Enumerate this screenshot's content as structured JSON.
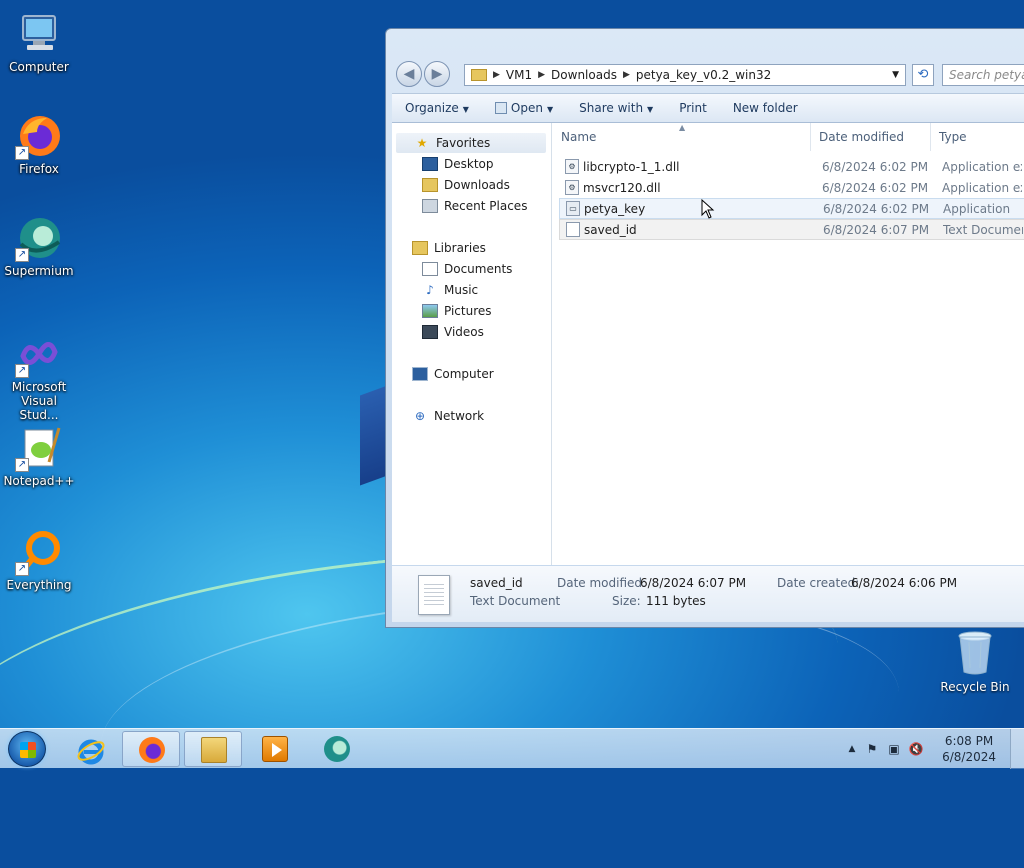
{
  "desktop": {
    "icons": [
      {
        "label": "Computer"
      },
      {
        "label": "Firefox"
      },
      {
        "label": "Supermium"
      },
      {
        "label": "Microsoft Visual Stud..."
      },
      {
        "label": "Notepad++"
      },
      {
        "label": "Everything"
      }
    ],
    "recycle_bin": "Recycle Bin"
  },
  "explorer": {
    "breadcrumb": [
      "VM1",
      "Downloads",
      "petya_key_v0.2_win32"
    ],
    "search_placeholder": "Search petya_k",
    "toolbar": {
      "organize": "Organize",
      "open": "Open",
      "share_with": "Share with",
      "print": "Print",
      "new_folder": "New folder"
    },
    "nav": {
      "favorites": "Favorites",
      "desktop": "Desktop",
      "downloads": "Downloads",
      "recent_places": "Recent Places",
      "libraries": "Libraries",
      "documents": "Documents",
      "music": "Music",
      "pictures": "Pictures",
      "videos": "Videos",
      "computer": "Computer",
      "network": "Network"
    },
    "columns": {
      "name": "Name",
      "date_modified": "Date modified",
      "type": "Type"
    },
    "files": [
      {
        "name": "libcrypto-1_1.dll",
        "date": "6/8/2024 6:02 PM",
        "type": "Application extension"
      },
      {
        "name": "msvcr120.dll",
        "date": "6/8/2024 6:02 PM",
        "type": "Application extension"
      },
      {
        "name": "petya_key",
        "date": "6/8/2024 6:02 PM",
        "type": "Application"
      },
      {
        "name": "saved_id",
        "date": "6/8/2024 6:07 PM",
        "type": "Text Document"
      }
    ],
    "details": {
      "name": "saved_id",
      "kind": "Text Document",
      "modified_label": "Date modified:",
      "modified_value": "6/8/2024 6:07 PM",
      "created_label": "Date created:",
      "created_value": "6/8/2024 6:06 PM",
      "size_label": "Size:",
      "size_value": "111 bytes"
    }
  },
  "taskbar": {
    "time": "6:08 PM",
    "date": "6/8/2024"
  }
}
